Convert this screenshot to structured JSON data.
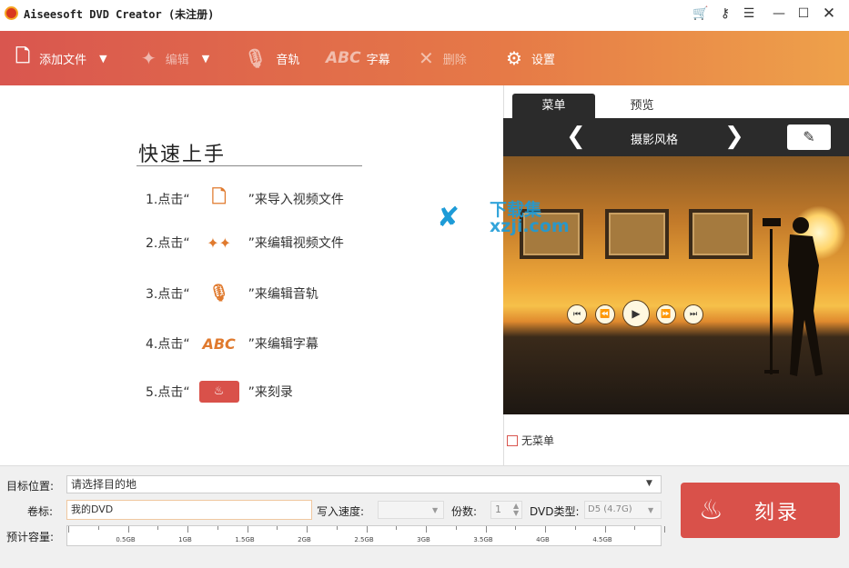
{
  "window": {
    "title": "Aiseesoft DVD Creator (未注册)"
  },
  "toolbar": {
    "add_file": "添加文件",
    "edit": "编辑",
    "audio": "音轨",
    "subtitle_abc": "ABC",
    "subtitle": "字幕",
    "delete": "删除",
    "settings": "设置"
  },
  "quick_start": {
    "title": "快速上手",
    "steps": [
      {
        "prefix": "1.点击“",
        "icon": "add-file-icon",
        "suffix": "”来导入视频文件"
      },
      {
        "prefix": "2.点击“",
        "icon": "edit-stars-icon",
        "suffix": "”来编辑视频文件"
      },
      {
        "prefix": "3.点击“",
        "icon": "mic-icon",
        "suffix": "”来编辑音轨"
      },
      {
        "prefix": "4.点击“",
        "icon": "abc-icon",
        "icon_text": "ABC",
        "suffix": "”来编辑字幕"
      },
      {
        "prefix": "5.点击“",
        "icon": "burn-icon",
        "suffix": "”来刻录"
      }
    ]
  },
  "menu_panel": {
    "tabs": [
      "菜单",
      "预览"
    ],
    "style_name": "摄影风格",
    "no_menu_label": "无菜单",
    "no_menu_checked": false
  },
  "watermark": {
    "text1": "下载集",
    "text2": "xzji.com"
  },
  "bottom": {
    "dest_label": "目标位置:",
    "dest_value": "请选择目的地",
    "volume_label": "卷标:",
    "volume_value": "我的DVD",
    "speed_label": "写入速度:",
    "speed_value": "",
    "copies_label": "份数:",
    "copies_value": "1",
    "dvdtype_label": "DVD类型:",
    "dvdtype_value": "D5 (4.7G)",
    "capacity_label": "预计容量:",
    "capacity_ticks": [
      "0.5GB",
      "1GB",
      "1.5GB",
      "2GB",
      "2.5GB",
      "3GB",
      "3.5GB",
      "4GB",
      "4.5GB"
    ],
    "burn_label": "刻录"
  },
  "colors": {
    "accent": "#d9514a",
    "toolbar_start": "#d9564f",
    "toolbar_end": "#eea14a",
    "dark_tab": "#2b2b2b"
  }
}
